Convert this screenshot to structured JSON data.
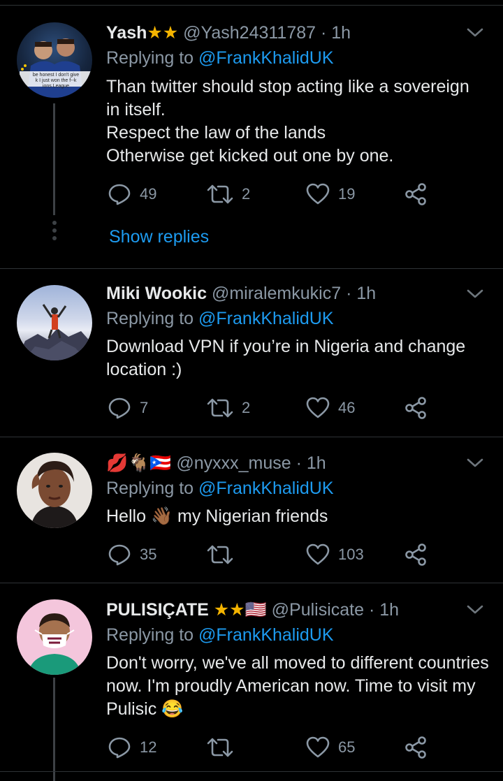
{
  "tweets": [
    {
      "name": "Yash",
      "badges": "★★",
      "handle": "@Yash24311787",
      "time": "· 1h",
      "replying_label": "Replying to ",
      "mention": "@FrankKhalidUK",
      "lines": [
        "Than twitter should stop acting like a sovereign",
        "in itself.",
        "Respect the law of the lands",
        "Otherwise get kicked out one by one."
      ],
      "reply_count": "49",
      "retweet_count": "2",
      "like_count": "19",
      "show_replies": "Show replies",
      "avatar_caption": [
        "be honest I don't give",
        "k I just won the f--k",
        "ions League"
      ]
    },
    {
      "name": "Miki Wookic",
      "handle": "@miralemkukic7",
      "time": "· 1h",
      "replying_label": "Replying to ",
      "mention": "@FrankKhalidUK",
      "lines": [
        "Download VPN if you’re in Nigeria and change",
        "location :)"
      ],
      "reply_count": "7",
      "retweet_count": "2",
      "like_count": "46"
    },
    {
      "name_emoji": "💋🐐🇵🇷",
      "handle": "@nyxxx_muse",
      "time": "· 1h",
      "replying_label": "Replying to ",
      "mention": "@FrankKhalidUK",
      "line_a": "Hello",
      "line_emoji": "👋🏾",
      "line_b": "my Nigerian friends",
      "reply_count": "35",
      "retweet_count": "",
      "like_count": "103"
    },
    {
      "name": "PULISIÇATE",
      "badges": "★★",
      "flag": "🇺🇸",
      "handle": "@Pulisicate",
      "time": "· 1h",
      "replying_label": "Replying to ",
      "mention": "@FrankKhalidUK",
      "lines": [
        "Don't worry, we've all moved to different countries",
        "now. I'm proudly American now. Time to visit my"
      ],
      "last_line": "Pulisic",
      "last_emoji": "😂",
      "reply_count": "12",
      "retweet_count": "",
      "like_count": "65"
    }
  ],
  "colors": {
    "background": "#000000",
    "text": "#e7e9ea",
    "muted": "#8b98a5",
    "accent": "#1d9bf0"
  }
}
